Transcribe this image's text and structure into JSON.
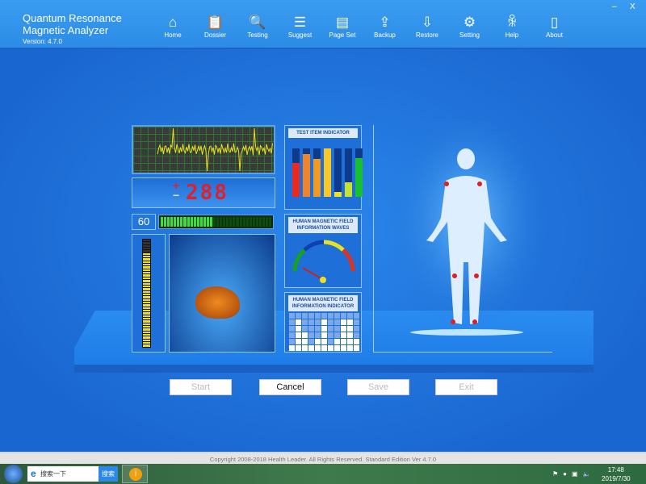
{
  "app": {
    "title_line1": "Quantum Resonance",
    "title_line2": "Magnetic Analyzer",
    "version": "Version: 4.7.0",
    "minimize": "–",
    "close": "X"
  },
  "nav": [
    {
      "label": "Home",
      "icon": "home-icon",
      "glyph": "⌂"
    },
    {
      "label": "Dossier",
      "icon": "clipboard-icon",
      "glyph": "📋"
    },
    {
      "label": "Testing",
      "icon": "magnifier-icon",
      "glyph": "🔍"
    },
    {
      "label": "Suggest",
      "icon": "list-icon",
      "glyph": "☰"
    },
    {
      "label": "Page Set",
      "icon": "window-icon",
      "glyph": "▤"
    },
    {
      "label": "Backup",
      "icon": "upload-icon",
      "glyph": "⇪"
    },
    {
      "label": "Restore",
      "icon": "download-icon",
      "glyph": "⇩"
    },
    {
      "label": "Setting",
      "icon": "gear-icon",
      "glyph": "⚙"
    },
    {
      "label": "Help",
      "icon": "help-user-icon",
      "glyph": "ꆜ"
    },
    {
      "label": "About",
      "icon": "book-icon",
      "glyph": "▯"
    }
  ],
  "display": {
    "sign_plus": "+",
    "sign_minus": "−",
    "value": "288",
    "level": "60",
    "green_level": 0.45,
    "yellow_level": 0.88
  },
  "panels": {
    "test_item": "TEST ITEM INDICATOR",
    "waves": "HUMAN MAGNETIC FIELD INFORMATION WAVES",
    "indicator": "HUMAN MAGNETIC FIELD INFORMATION INDICATOR"
  },
  "indicator_bars": [
    {
      "color": "#e82a20",
      "value": 0.7
    },
    {
      "color": "#f0842a",
      "value": 0.88
    },
    {
      "color": "#f09a22",
      "value": 0.78
    },
    {
      "color": "#f8c828",
      "value": 1.0
    },
    {
      "color": "#f0e020",
      "value": 0.1
    },
    {
      "color": "#c8e030",
      "value": 0.3
    },
    {
      "color": "#18c030",
      "value": 0.8
    }
  ],
  "buttons": {
    "start": "Start",
    "cancel": "Cancel",
    "save": "Save",
    "exit": "Exit"
  },
  "status": "Copyright 2008-2018 Health Leader. All Rights Reserved.  Standard Edition Ver 4.7.0",
  "taskbar": {
    "search_placeholder": "搜索一下",
    "search_button": "搜索",
    "time": "17:48",
    "date": "2019/7/30"
  }
}
